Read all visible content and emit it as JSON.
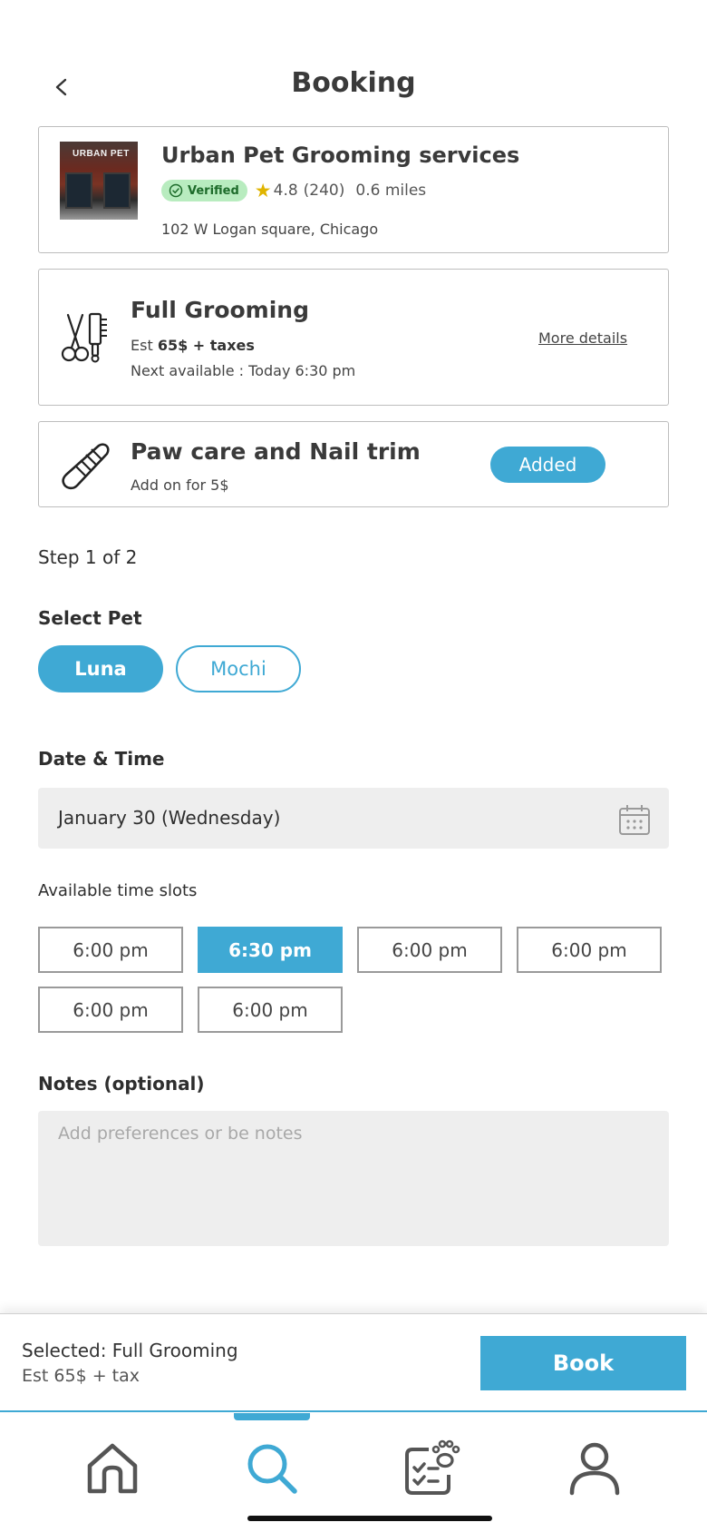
{
  "header": {
    "title": "Booking",
    "back_icon": "chevron-left-icon"
  },
  "shop": {
    "name": "Urban Pet Grooming services",
    "thumbnail_sign": "URBAN PET",
    "verified_label": "Verified",
    "rating": "4.8",
    "reviews": "(240)",
    "distance": "0.6 miles",
    "address": "102 W Logan square, Chicago"
  },
  "service": {
    "title": "Full Grooming",
    "price_prefix": "Est",
    "price_bold": "65$ + taxes",
    "next_available": "Next available : Today 6:30 pm",
    "more_details": "More details",
    "icon": "grooming-tools-icon"
  },
  "addon": {
    "title": "Paw care and Nail trim",
    "subtitle": "Add on for 5$",
    "button": "Added",
    "icon": "nail-file-icon"
  },
  "step": "Step 1 of 2",
  "pets": {
    "label": "Select Pet",
    "options": [
      "Luna",
      "Mochi"
    ],
    "selected": "Luna"
  },
  "date_time": {
    "label": "Date & Time",
    "date_value": "January 30 (Wednesday)",
    "icon": "calendar-icon"
  },
  "slots": {
    "label": "Available time slots",
    "items": [
      "6:00 pm",
      "6:30 pm",
      "6:00 pm",
      "6:00 pm",
      "6:00 pm",
      "6:00 pm"
    ],
    "selected_index": 1
  },
  "notes": {
    "label": "Notes (optional)",
    "placeholder": "Add preferences or be notes"
  },
  "summary": {
    "selected": "Selected: Full Grooming",
    "price": "Est 65$ + tax",
    "book_button": "Book"
  },
  "tabbar": {
    "items": [
      "home-icon",
      "search-icon",
      "pet-checklist-icon",
      "profile-icon"
    ],
    "active": "search-icon"
  },
  "colors": {
    "accent": "#3fa9d4",
    "verified_bg": "#b8ecbf",
    "star": "#e0b400",
    "field_bg": "#eeeeee"
  }
}
